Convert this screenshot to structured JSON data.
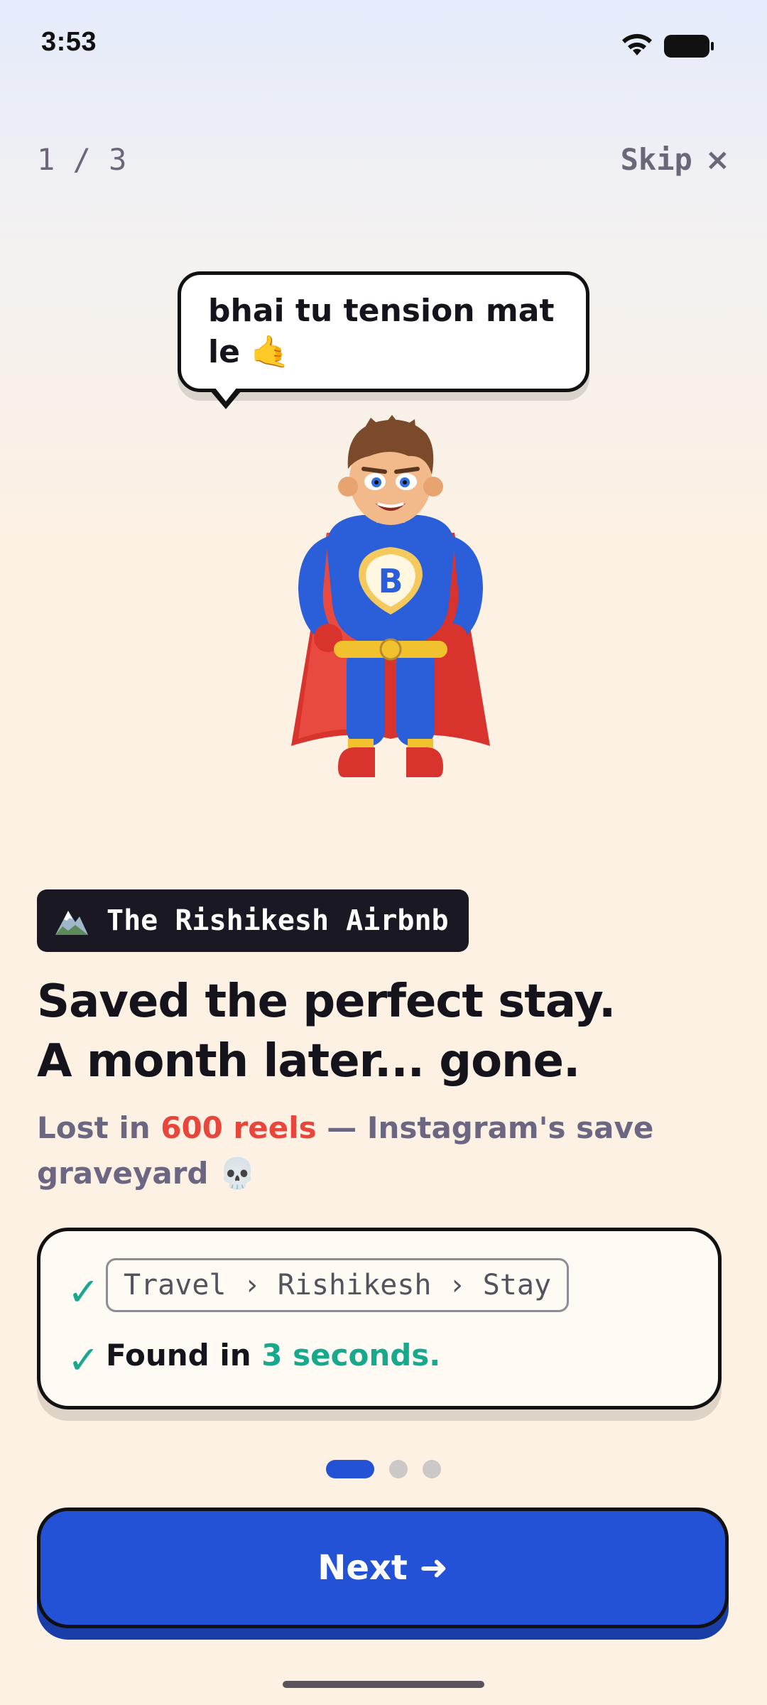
{
  "status_bar": {
    "time": "3:53"
  },
  "onboarding": {
    "progress": "1 / 3",
    "skip_label": "Skip",
    "skip_icon": "×",
    "speech_bubble": "bhai tu tension mat le 🤙",
    "tag": {
      "icon": "mountain-icon",
      "label": "The Rishikesh Airbnb"
    },
    "headline_line1": "Saved the perfect stay.",
    "headline_line2": "A month later... gone.",
    "subtext": {
      "before": "Lost in ",
      "highlight": "600 reels",
      "after": " — Instagram's save graveyard 💀"
    },
    "card": {
      "path_chip": "Travel › Rishikesh › Stay",
      "found_prefix": "Found in ",
      "found_highlight": "3 seconds.",
      "check_glyph": "✓"
    },
    "pagination": {
      "current": 1,
      "total": 3
    },
    "next_label": "Next ➜"
  },
  "colors": {
    "accent": "#2452d6",
    "highlight_red": "#e8453c",
    "success_green": "#17a98c",
    "dark": "#15131c"
  }
}
